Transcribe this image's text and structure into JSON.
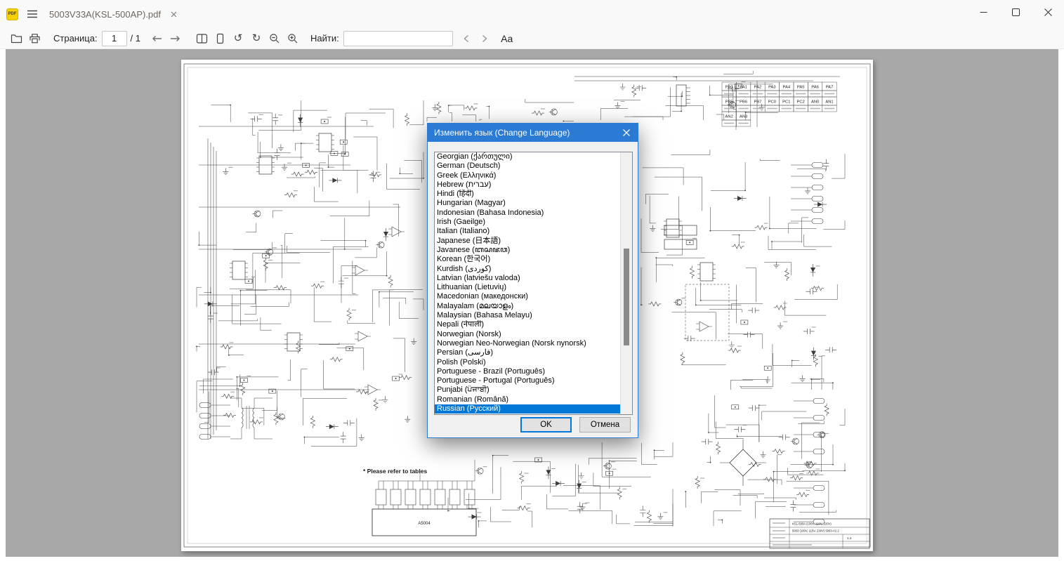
{
  "window": {
    "app_icon_label": "PDF",
    "tab_title": "5003V33A(KSL-500AP).pdf"
  },
  "toolbar": {
    "page_label": "Страница:",
    "page_value": "1",
    "page_total": "/ 1",
    "find_label": "Найти:",
    "find_value": "",
    "case_label": "Aa"
  },
  "dialog": {
    "title": "Изменить язык (Change Language)",
    "ok_label": "OK",
    "cancel_label": "Отмена",
    "selected_index": 27,
    "languages": [
      "Georgian (ქართული)",
      "German (Deutsch)",
      "Greek (Ελληνικά)",
      "Hebrew (עברית)",
      "Hindi (हिंदी)",
      "Hungarian (Magyar)",
      "Indonesian (Bahasa Indonesia)",
      "Irish (Gaeilge)",
      "Italian (Italiano)",
      "Japanese (日本語)",
      "Javanese (ꦧꦱꦗꦮ)",
      "Korean (한국어)",
      "Kurdish (کوردی)",
      "Latvian (latviešu valoda)",
      "Lithuanian (Lietuvių)",
      "Macedonian (македонски)",
      "Malayalam (മലയാളം)",
      "Malaysian (Bahasa Melayu)",
      "Nepali (नेपाली)",
      "Norwegian (Norsk)",
      "Norwegian Neo-Norwegian (Norsk nynorsk)",
      "Persian (فارسی)",
      "Polish (Polski)",
      "Portuguese - Brazil (Português)",
      "Portuguese - Portugal (Português)",
      "Punjabi (ਪੰਜਾਬੀ)",
      "Romanian (Română)",
      "Russian (Русский)"
    ]
  },
  "document": {
    "note": "* Please refer to tables",
    "module_label": "A5004",
    "pin_table": {
      "row1": [
        "PA0",
        "PA1",
        "PA2",
        "PA3",
        "PA4",
        "PA5",
        "PA6",
        "PA7"
      ],
      "row2": [
        "PB5",
        "PB6",
        "PB7",
        "PC0",
        "PC1",
        "PC2",
        "AN0",
        "AN1"
      ],
      "row3": [
        "AN2",
        "AN3"
      ]
    },
    "title_block": {
      "model": "KSL-500A (100V, 110V, 220V)",
      "number": "5003 (100V, 115V, 230V) 5003-V2.2",
      "rev": "1.2"
    }
  }
}
